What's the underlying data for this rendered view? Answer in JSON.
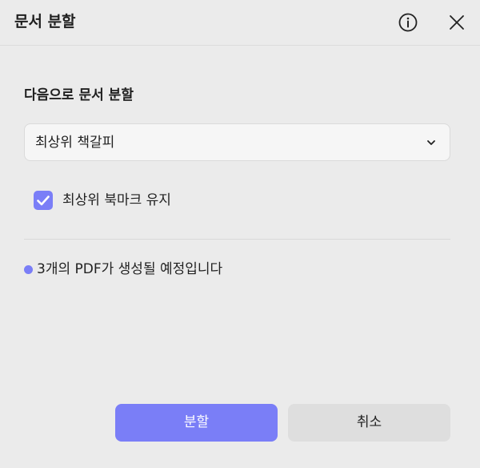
{
  "dialog": {
    "title": "문서 분할",
    "header_icons": [
      "info-icon",
      "close-icon"
    ]
  },
  "split": {
    "label": "다음으로 문서 분할",
    "selected_option": "최상위 책갈피"
  },
  "keep_bookmarks": {
    "label": "최상위 북마크 유지",
    "checked": true
  },
  "result": {
    "text": "3개의 PDF가 생성될 예정입니다"
  },
  "buttons": {
    "split_label": "분할",
    "cancel_label": "취소"
  },
  "colors": {
    "accent": "#7a7ef7",
    "background": "#ebebeb",
    "secondary_button": "#dedede"
  }
}
